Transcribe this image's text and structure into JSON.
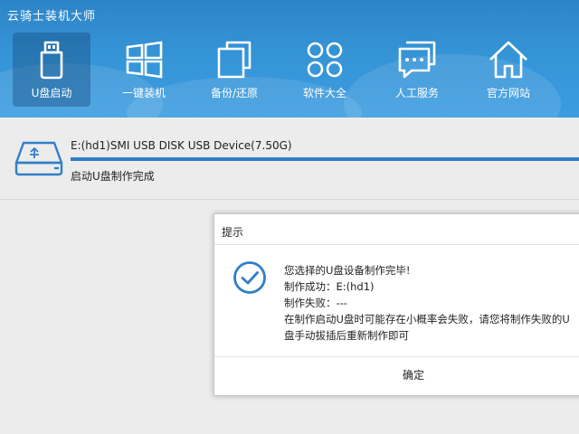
{
  "app": {
    "title": "云骑士装机大师"
  },
  "nav": {
    "items": [
      {
        "label": "U盘启动",
        "icon": "usb-drive-icon",
        "active": true
      },
      {
        "label": "一键装机",
        "icon": "windows-icon",
        "active": false
      },
      {
        "label": "备份/还原",
        "icon": "backup-copy-icon",
        "active": false
      },
      {
        "label": "软件大全",
        "icon": "apps-grid-icon",
        "active": false
      },
      {
        "label": "人工服务",
        "icon": "chat-bubble-icon",
        "active": false
      },
      {
        "label": "官方网站",
        "icon": "home-icon",
        "active": false
      }
    ]
  },
  "device": {
    "name": "E:(hd1)SMI USB DISK USB Device(7.50G)",
    "progress_fraction": 1.0,
    "status": "启动U盘制作完成",
    "icon": "usb-writer-icon"
  },
  "dialog": {
    "title": "提示",
    "icon": "success-check-icon",
    "lines": [
      "您选择的U盘设备制作完毕!",
      "制作成功：E:(hd1)",
      "制作失败：---",
      "在制作启动U盘时可能存在小概率会失败，请您将制作失败的U",
      "盘手动拔插后重新制作即可"
    ],
    "ok_label": "确定"
  },
  "colors": {
    "header_blue": "#3594d6",
    "accent_blue": "#2f7fc8",
    "content_bg": "#ececec"
  }
}
